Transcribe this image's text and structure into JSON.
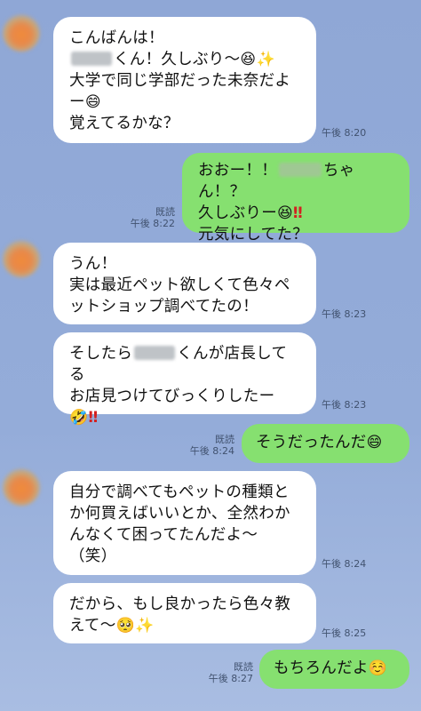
{
  "messages": [
    {
      "line1_pre": "こんばんは！",
      "line2_post": "くん！久しぶり〜",
      "line2_emoji": "😆",
      "line2_emoji2": "✨",
      "line3": "大学で同じ学部だった未奈だよ",
      "line4_pre": "ー",
      "line4_emoji": "😄",
      "line5": "覚えてるかな？",
      "time": "午後 8:20"
    },
    {
      "line1_pre": "おおー！！",
      "line1_post": "ちゃん！？",
      "line2_pre": "久しぶりー",
      "line2_emoji": "😆",
      "line2_excl": "‼",
      "line3": "元気にしてた？",
      "read": "既読",
      "time": "午後 8:22"
    },
    {
      "line1": "うん！",
      "line2": "実は最近ペット欲しくて色々ペ",
      "line3": "ットショップ調べてたの！",
      "time": "午後 8:23"
    },
    {
      "line1_pre": "そしたら",
      "line1_post": "くんが店長してる",
      "line2": "お店見つけてびっくりしたー",
      "line3_emoji": "🤣",
      "line3_excl": "‼",
      "time": "午後 8:23"
    },
    {
      "text": "そうだったんだ",
      "emoji": "😄",
      "read": "既読",
      "time": "午後 8:24"
    },
    {
      "line1": "自分で調べてもペットの種類と",
      "line2": "か何買えばいいとか、全然わか",
      "line3": "んなくて困ってたんだよ〜",
      "line4": "（笑）",
      "time": "午後 8:24"
    },
    {
      "line1": "だから、もし良かったら色々教",
      "line2_pre": "えて〜",
      "line2_emoji": "🥺",
      "line2_emoji2": "✨",
      "time": "午後 8:25"
    },
    {
      "text": "もちろんだよ",
      "emoji": "☺️",
      "read": "既読",
      "time": "午後 8:27"
    }
  ]
}
